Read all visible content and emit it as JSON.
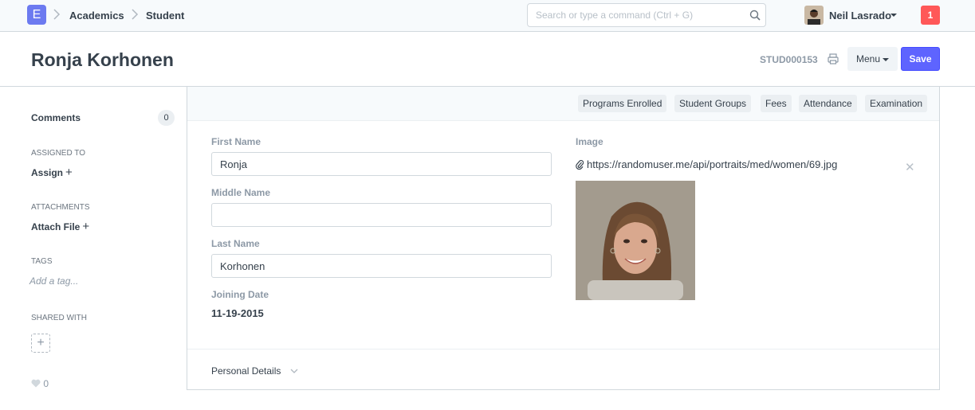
{
  "app": {
    "logo_letter": "E"
  },
  "breadcrumb": [
    {
      "label": "Academics"
    },
    {
      "label": "Student"
    }
  ],
  "search": {
    "placeholder": "Search or type a command (Ctrl + G)"
  },
  "user": {
    "name": "Neil Lasrado",
    "notifications": "1"
  },
  "page": {
    "title": "Ronja Korhonen",
    "doc_id": "STUD000153",
    "menu_label": "Menu",
    "save_label": "Save"
  },
  "sidebar": {
    "comments_label": "Comments",
    "comments_count": "0",
    "assigned_to_label": "ASSIGNED TO",
    "assign_label": "Assign",
    "attachments_label": "ATTACHMENTS",
    "attach_label": "Attach File",
    "tags_label": "TAGS",
    "tag_placeholder": "Add a tag...",
    "shared_with_label": "SHARED WITH",
    "likes": "0"
  },
  "links": [
    {
      "label": "Programs Enrolled"
    },
    {
      "label": "Student Groups"
    },
    {
      "label": "Fees"
    },
    {
      "label": "Attendance"
    },
    {
      "label": "Examination"
    }
  ],
  "form": {
    "first_name_label": "First Name",
    "first_name_value": "Ronja",
    "middle_name_label": "Middle Name",
    "middle_name_value": "",
    "last_name_label": "Last Name",
    "last_name_value": "Korhonen",
    "joining_date_label": "Joining Date",
    "joining_date_value": "11-19-2015",
    "image_label": "Image",
    "image_url": "https://randomuser.me/api/portraits/med/women/69.jpg",
    "section_label": "Personal Details"
  },
  "colors": {
    "accent": "#5e64ff",
    "logo": "#6c7af0",
    "notification": "#ff5858"
  },
  "icons": [
    "search-icon",
    "print-icon",
    "paperclip-icon",
    "close-icon",
    "heart-icon",
    "chevron-down-icon",
    "plus-icon"
  ]
}
